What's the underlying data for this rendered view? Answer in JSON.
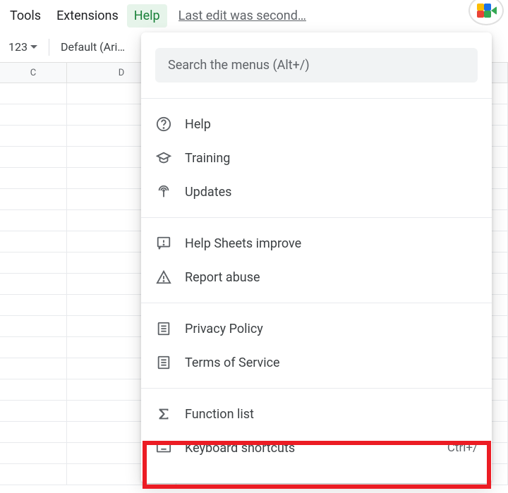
{
  "menubar": {
    "tools": "Tools",
    "extensions": "Extensions",
    "help": "Help",
    "last_edit": "Last edit was second…"
  },
  "toolbar": {
    "format": "123",
    "font": "Default (Ari…"
  },
  "columns": [
    "C",
    "D"
  ],
  "help_menu": {
    "search_placeholder": "Search the menus (Alt+/)",
    "items": {
      "help": "Help",
      "training": "Training",
      "updates": "Updates",
      "improve": "Help Sheets improve",
      "report": "Report abuse",
      "privacy": "Privacy Policy",
      "terms": "Terms of Service",
      "functions": "Function list",
      "shortcuts": "Keyboard shortcuts",
      "shortcuts_key": "Ctrl+/"
    }
  }
}
